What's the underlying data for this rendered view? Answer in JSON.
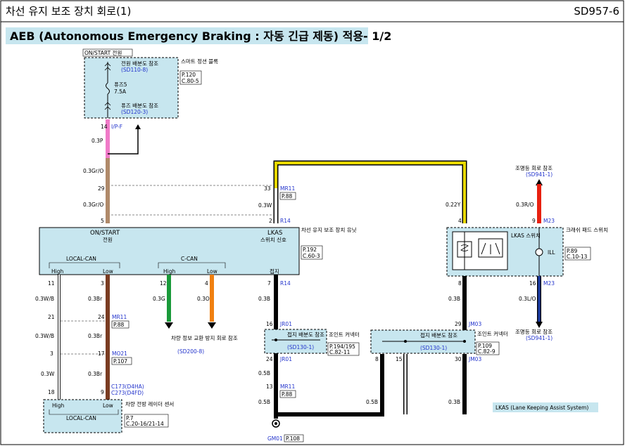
{
  "header": {
    "title": "차선 유지 보조 장치 회로(1)",
    "code": "SD957-6"
  },
  "subtitle": "AEB (Autonomous Emergency Braking : 자동 긴급 제동) 적용- 1/2",
  "fuse_box": {
    "mode": "ON/START 전원",
    "top_ref_label": "전원 배분도 참조",
    "top_ref": "(SD110-8)",
    "name": "스마트 정션 블록",
    "page": "P.120",
    "conn": "C.80-5",
    "fuse": "퓨즈5",
    "amp": "7.5A",
    "bottom_ref_label": "퓨즈 배분도 참조",
    "bottom_ref": "(SD120-3)"
  },
  "wires": {
    "w1_pin": "14",
    "w1_conn": "I/P-F",
    "w1_color": "0.3P",
    "w2_color": "0.3Gr/O",
    "w2_pin": "29",
    "w3_color": "0.3Gr/O",
    "w3_pin": "5",
    "y_pin33": "33",
    "y_conn": "MR11",
    "y_page": "P.88",
    "y_color": "0.3W",
    "y_pin2": "2",
    "y_conn2": "R14",
    "y_right_color": "0.22Y",
    "y_right_pin": "4"
  },
  "lkas_unit": {
    "on_start": "ON/START",
    "power": "전원",
    "lkas": "LKAS",
    "switch_signal": "스위치 신호",
    "name": "차선 유지 보조 장치 유닛",
    "page": "P.192",
    "conn": "C.60-3",
    "local_can": "LOCAL-CAN",
    "c_can": "C-CAN",
    "high": "High",
    "low": "Low",
    "high2": "High",
    "low2": "Low",
    "ground": "접지",
    "gnd_conn": "R14"
  },
  "left_wires": {
    "p11": "11",
    "c11": "0.3W/B",
    "p3": "3",
    "c3": "0.3Br",
    "p21": "21",
    "c21": "0.3W/B",
    "p24": "24",
    "mr11": "MR11",
    "p88": "P.88",
    "c24": "0.3Br",
    "p3b": "3",
    "c3b": "0.3W",
    "p17": "17",
    "mo21": "MO21",
    "p107": "P.107",
    "c17": "0.3Br",
    "p18": "18",
    "p9": "9",
    "c173": "C173(D4HA)",
    "c273": "C273(D4FD)"
  },
  "ccan_wires": {
    "p12": "12",
    "c12": "0.3G",
    "p4": "4",
    "c4": "0.3O",
    "ref_label": "차량 정보 교환 방지 회로 참조",
    "ref": "(SD200-8)"
  },
  "vehicle_sensor": {
    "high": "High",
    "low": "Low",
    "bus": "LOCAL-CAN",
    "name": "차량 전방 레이더 센서",
    "page": "P.7",
    "conn": "C.20-16/21-14"
  },
  "ground_path": {
    "p7": "7",
    "c7": "0.3B",
    "p16": "16",
    "jr01": "JR01",
    "jbox_label": "접지 배분도 참조",
    "jbox_ref": "(SD130-1)",
    "jbox_name": "조인트 커넥터",
    "jbox_page": "P.194/195",
    "jbox_conn": "C.82-11",
    "p24": "24",
    "jr01b": "JR01",
    "c24": "0.5B",
    "p13": "13",
    "mr11": "MR11",
    "p88": "P.88",
    "c13": "0.5B",
    "gm01": "GM01",
    "p108": "P.108"
  },
  "switch": {
    "name": "LKAS 스위치",
    "ill": "ILL",
    "unit": "크래쉬 패드 스위치",
    "page": "P.89",
    "conn": "C.10-13",
    "pin8": "8",
    "c8": "0.3B",
    "pin29": "29",
    "jm03": "JM03",
    "jbox_label": "접지 배분도 참조",
    "jbox_ref": "(SD130-1)",
    "jbox_name": "조인트 커넥터",
    "jbox_page": "P.109",
    "jbox_conn": "C.82-9",
    "p8": "8",
    "p15": "15",
    "p30": "30",
    "jm03b": "JM03",
    "c05b": "0.5B",
    "c03b": "0.3B"
  },
  "ill_circuit": {
    "top_ref_label": "조명등 회로 참조",
    "top_ref": "(SD941-1)",
    "c_top": "0.3R/O",
    "pin9": "9",
    "m23": "M23",
    "pin16": "16",
    "m23b": "M23",
    "c_bot": "0.3L/O",
    "bot_ref_label": "조명등 회로 참조",
    "bot_ref": "(SD941-1)"
  },
  "legend": "LKAS (Lane Keeping Assist System)",
  "colors": {
    "pink": "#f07ac8",
    "brown_orange": "#b08a6a",
    "yellow": "#e8d800",
    "black": "#000000",
    "brown": "#7a3c22",
    "green": "#1a9a3a",
    "orange": "#f08010",
    "red": "#e82010",
    "navy": "#1a3aa0",
    "panel": "#c7e6ef"
  }
}
